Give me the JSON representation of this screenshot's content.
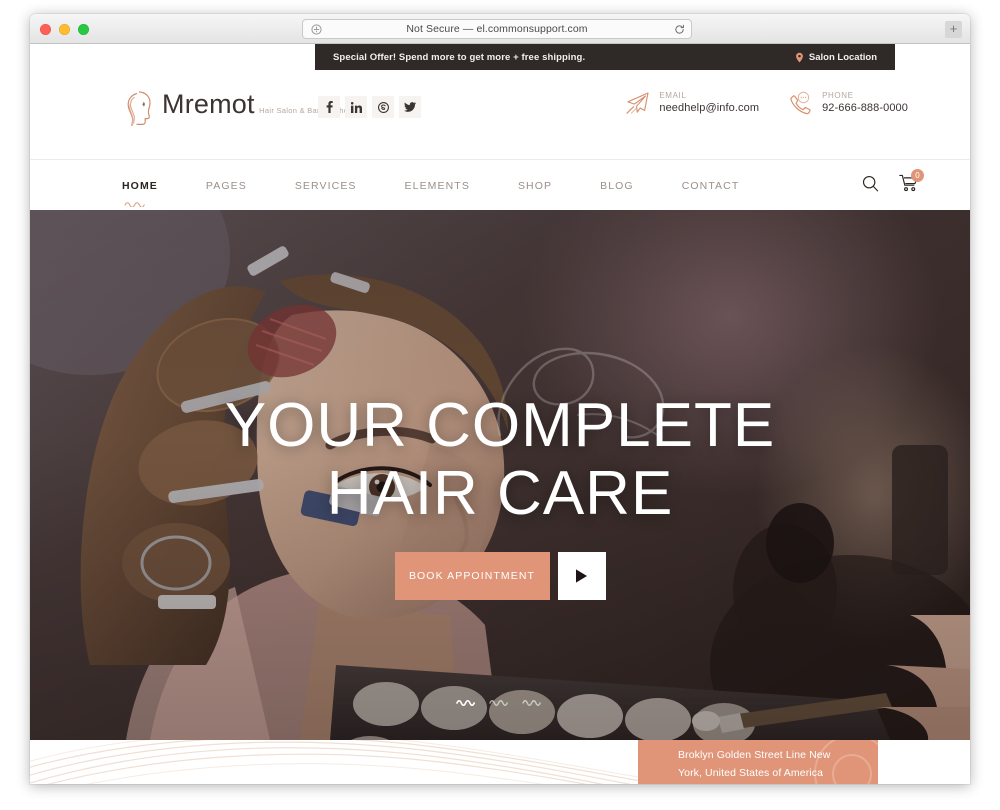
{
  "browser": {
    "url_text": "Not Secure — el.commonsupport.com",
    "shield_icon": "info-circle-icon",
    "reload_icon": "reload-icon",
    "newtab_label": "+",
    "traffic_lights": [
      "close",
      "minimize",
      "zoom"
    ]
  },
  "promo": {
    "text": "Special Offer! Spend more to get more + free shipping.",
    "location_label": "Salon Location",
    "pin_icon": "map-pin-icon",
    "bg_color": "#2F2A28"
  },
  "brand": {
    "name": "Mremot",
    "tagline": "Hair Salon & Barber Shop",
    "logo_icon": "woman-head-logo-icon"
  },
  "social": [
    {
      "name": "facebook",
      "glyph": "f"
    },
    {
      "name": "linkedin",
      "glyph": "in"
    },
    {
      "name": "skype",
      "glyph": "S"
    },
    {
      "name": "twitter",
      "glyph": "✈"
    }
  ],
  "contact": {
    "email": {
      "label": "EMAIL",
      "value": "needhelp@info.com",
      "icon": "paper-plane-icon"
    },
    "phone": {
      "label": "PHONE",
      "value": "92-666-888-0000",
      "icon": "phone-icon"
    }
  },
  "nav": {
    "items": [
      {
        "label": "HOME",
        "active": true
      },
      {
        "label": "PAGES",
        "active": false
      },
      {
        "label": "SERVICES",
        "active": false
      },
      {
        "label": "ELEMENTS",
        "active": false
      },
      {
        "label": "SHOP",
        "active": false
      },
      {
        "label": "BLOG",
        "active": false
      },
      {
        "label": "CONTACT",
        "active": false
      }
    ],
    "search_icon": "search-icon",
    "cart_icon": "shopping-cart-icon",
    "cart_count": "0"
  },
  "hero": {
    "title_line1": "YOUR COMPLETE",
    "title_line2": "HAIR CARE",
    "book_button": "BOOK APPOINTMENT",
    "play_icon": "play-icon",
    "accent_color": "#E09578",
    "slider_dots": 3,
    "active_dot": 1
  },
  "address_card": {
    "line1": "Broklyn Golden Street Line New",
    "line2": "York, United States of America",
    "bg_color": "#E09578"
  }
}
